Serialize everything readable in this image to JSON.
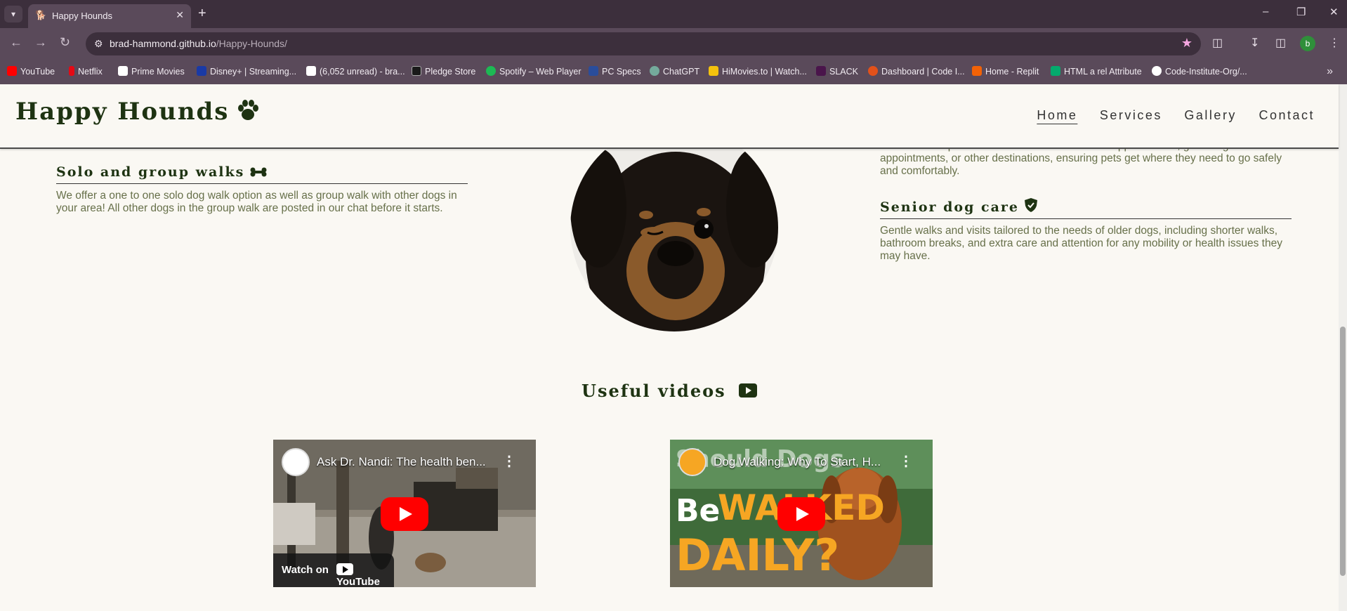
{
  "browser": {
    "tab_title": "Happy Hounds",
    "url_host": "brad-hammond.github.io",
    "url_path": "/Happy-Hounds/",
    "profile_initial": "b",
    "bookmarks": [
      {
        "label": "YouTube",
        "color": "#ff0000"
      },
      {
        "label": "Netflix",
        "color": "#e50914"
      },
      {
        "label": "Prime Movies",
        "color": "#ffffff"
      },
      {
        "label": "Disney+ | Streaming...",
        "color": "#1a3aa5"
      },
      {
        "label": "(6,052 unread) - bra...",
        "color": "#ffffff"
      },
      {
        "label": "Pledge Store",
        "color": "#1a1a1a"
      },
      {
        "label": "Spotify – Web Player",
        "color": "#1db954"
      },
      {
        "label": "PC Specs",
        "color": "#2a4d9b"
      },
      {
        "label": "ChatGPT",
        "color": "#74aa9c"
      },
      {
        "label": "HiMovies.to | Watch...",
        "color": "#f4c20d"
      },
      {
        "label": "SLACK",
        "color": "#4a154b"
      },
      {
        "label": "Dashboard | Code I...",
        "color": "#e2511a"
      },
      {
        "label": "Home - Replit",
        "color": "#f26207"
      },
      {
        "label": "HTML a rel Attribute",
        "color": "#04aa6d"
      },
      {
        "label": "Code-Institute-Org/...",
        "color": "#ffffff"
      }
    ]
  },
  "site": {
    "logo": "Happy Hounds",
    "nav": [
      "Home",
      "Services",
      "Gallery",
      "Contact"
    ],
    "services": {
      "solo": {
        "title": "Solo and group walks",
        "text": "We offer a one to one solo dog walk option as well as group walk with other dogs in your area! All other dogs in the group walk are posted in our chat before it starts."
      },
      "transport": {
        "text": "We offer transportation services to and from vet appointments, grooming appointments, or other destinations, ensuring pets get where they need to go safely and comfortably."
      },
      "senior": {
        "title": "Senior dog care",
        "text": "Gentle walks and visits tailored to the needs of older dogs, including shorter walks, bathroom breaks, and extra care and attention for any mobility or health issues they may have."
      }
    },
    "videos_title": "Useful videos",
    "videos": [
      {
        "title": "Ask Dr. Nandi: The health ben...",
        "watch_on": "Watch on",
        "brand": "YouTube"
      },
      {
        "title": "Dog Walking: Why To Start, H...",
        "thumb_line1": "Be",
        "thumb_line2": "WALKED",
        "thumb_line3": "DAILY?",
        "thumb_top": "Should Dogs"
      }
    ]
  }
}
